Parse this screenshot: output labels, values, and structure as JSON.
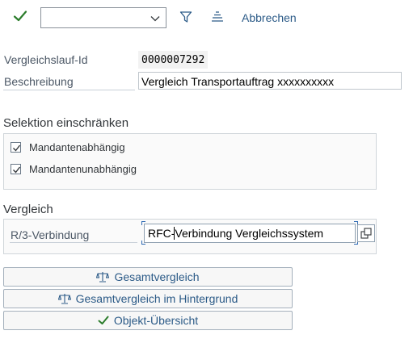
{
  "toolbar": {
    "confirm_icon": "checkmark-icon",
    "select_value": "",
    "filter_icon": "filter-icon",
    "sort_icon": "sort-icon",
    "cancel_label": "Abbrechen"
  },
  "form": {
    "run_id_label": "Vergleichslauf-Id",
    "run_id_value": "0000007292",
    "description_label": "Beschreibung",
    "description_value": "Vergleich Transportauftrag xxxxxxxxxx"
  },
  "selection": {
    "title": "Selektion einschränken",
    "options": [
      {
        "label": "Mandantenabhängig",
        "checked": true
      },
      {
        "label": "Mandantenunabhängig",
        "checked": true
      }
    ]
  },
  "comparison": {
    "title": "Vergleich",
    "r3_label": "R/3-Verbindung",
    "r3_value": "RFC-Verbindung Vergleichssystem",
    "value_help_icon": "value-help-icon"
  },
  "buttons": {
    "total": {
      "label": "Gesamtvergleich",
      "icon": "scales-icon"
    },
    "background": {
      "label": "Gesamtvergleich im Hintergrund",
      "icon": "scales-icon"
    },
    "overview": {
      "label": "Objekt-Übersicht",
      "icon": "checkmark-icon"
    }
  },
  "colors": {
    "accent": "#2b5a87",
    "confirm_green": "#2b7c2b",
    "focus": "#2e69b3"
  }
}
